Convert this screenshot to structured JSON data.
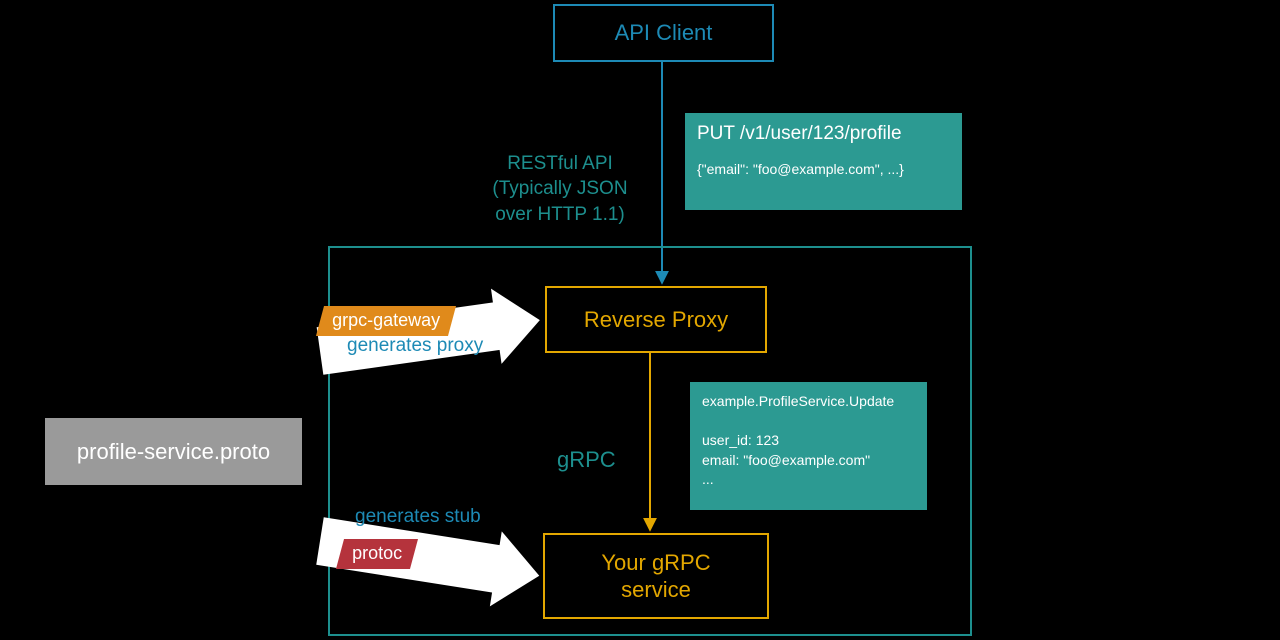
{
  "nodes": {
    "api_client": "API Client",
    "reverse_proxy": "Reverse Proxy",
    "grpc_service": "Your gRPC\nservice",
    "proto_file": "profile-service.proto"
  },
  "labels": {
    "rest_api": "RESTful API\n(Typically JSON\nover HTTP 1.1)",
    "grpc": "gRPC",
    "grpc_gateway_badge": "grpc-gateway",
    "generates_proxy": "generates proxy",
    "generates_stub": "generates stub",
    "protoc_badge": "protoc"
  },
  "request_http": {
    "method_line": "PUT /v1/user/123/profile",
    "body_line": "{\"email\": \"foo@example.com\", ...}"
  },
  "request_grpc": {
    "text": "example.ProfileService.Update\n\nuser_id: 123\nemail: \"foo@example.com\"\n..."
  },
  "colors": {
    "teal": "#2c9a92",
    "teal_line": "#1d8f8e",
    "blue": "#1d8ab5",
    "gold": "#e3a700",
    "orange": "#e08a1b",
    "red": "#b5333c",
    "gray": "#9a9a9a"
  }
}
